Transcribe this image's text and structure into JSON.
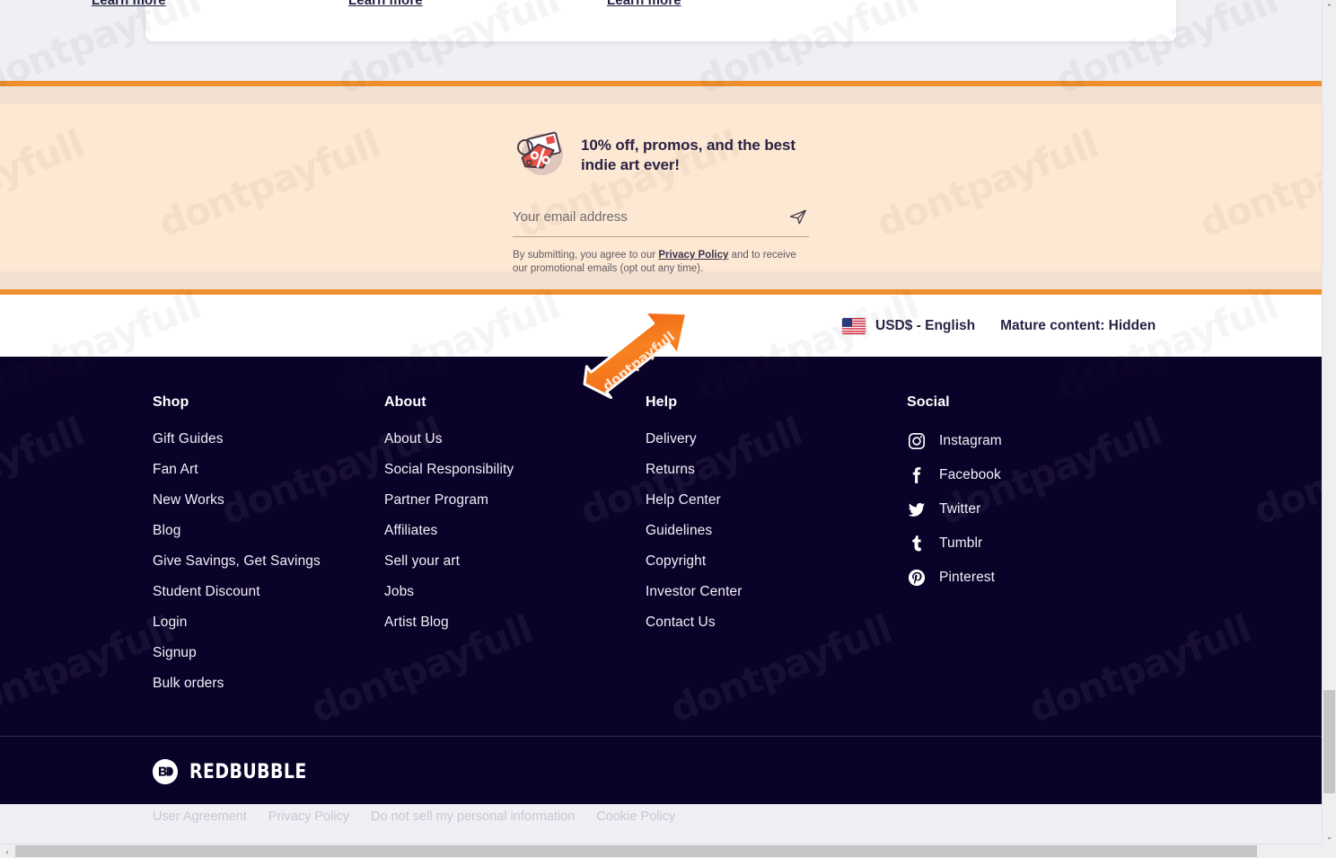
{
  "top_card": {
    "learn_more_links": [
      "Learn more",
      "Learn more",
      "Learn more"
    ]
  },
  "promo": {
    "icon": "discount-tag-envelope-icon",
    "title": "10% off, promos, and the best indie art ever!",
    "email_placeholder": "Your email address",
    "email_value": "",
    "send_icon": "send-paper-plane-icon",
    "legal_prefix": "By submitting, you agree to our ",
    "legal_link": "Privacy Policy",
    "legal_suffix": " and to receive our promotional emails (opt out any time).",
    "border_color": "#ef8f2e",
    "background_color": "#fde8d3"
  },
  "locale_bar": {
    "flag_icon": "us-flag-icon",
    "currency_language": "USD$ - English",
    "mature_content": "Mature content: Hidden"
  },
  "annotation": {
    "label": "dontpayfull",
    "icon": "up-right-arrow-annotation",
    "color": "#f4701f"
  },
  "footer": {
    "columns": [
      {
        "heading": "Shop",
        "links": [
          "Gift Guides",
          "Fan Art",
          "New Works",
          "Blog",
          "Give Savings, Get Savings",
          "Student Discount",
          "Login",
          "Signup",
          "Bulk orders"
        ]
      },
      {
        "heading": "About",
        "links": [
          "About Us",
          "Social Responsibility",
          "Partner Program",
          "Affiliates",
          "Sell your art",
          "Jobs",
          "Artist Blog"
        ]
      },
      {
        "heading": "Help",
        "links": [
          "Delivery",
          "Returns",
          "Help Center",
          "Guidelines",
          "Copyright",
          "Investor Center",
          "Contact Us"
        ]
      }
    ],
    "social": {
      "heading": "Social",
      "links": [
        {
          "label": "Instagram",
          "icon": "instagram-icon"
        },
        {
          "label": "Facebook",
          "icon": "facebook-icon"
        },
        {
          "label": "Twitter",
          "icon": "twitter-icon"
        },
        {
          "label": "Tumblr",
          "icon": "tumblr-icon"
        },
        {
          "label": "Pinterest",
          "icon": "pinterest-icon"
        }
      ]
    },
    "brand": {
      "mark": "rb-logo-icon",
      "name": "REDBUBBLE"
    },
    "legal_links": [
      "User Agreement",
      "Privacy Policy",
      "Do not sell my personal information",
      "Cookie Policy"
    ],
    "background_color": "#0b0229"
  },
  "watermark": {
    "text": "dontpayfull"
  },
  "scrollbars": {
    "vertical_up": "⌃",
    "vertical_down": "⌄",
    "horizontal_left": "‹",
    "horizontal_right": "›"
  }
}
